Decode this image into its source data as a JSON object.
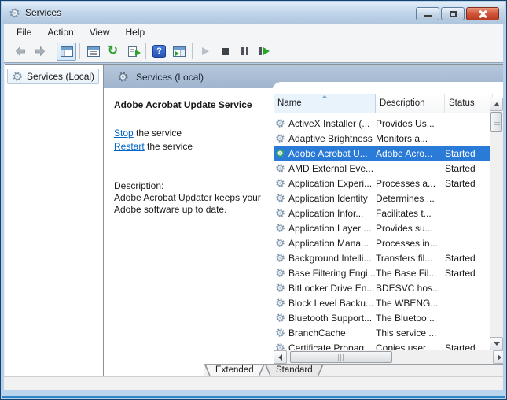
{
  "window": {
    "title": "Services"
  },
  "menu": {
    "items": [
      {
        "label": "File"
      },
      {
        "label": "Action"
      },
      {
        "label": "View"
      },
      {
        "label": "Help"
      }
    ]
  },
  "toolbar": {
    "icons": [
      "back",
      "forward",
      "show-console-tree",
      "properties",
      "refresh",
      "export-list",
      "help",
      "show-action-pane",
      "start-service",
      "stop-service",
      "pause-service",
      "restart-service"
    ],
    "help_glyph": "?",
    "refresh_glyph": "↻"
  },
  "sidebar": {
    "root_label": "Services (Local)"
  },
  "extended_pane": {
    "header": "Services (Local)",
    "service_title": "Adobe Acrobat Update Service",
    "stop_link": "Stop",
    "stop_suffix": " the service",
    "restart_link": "Restart",
    "restart_suffix": " the service",
    "description_label": "Description:",
    "description_text": "Adobe Acrobat Updater keeps your Adobe software up to date."
  },
  "services": {
    "columns": [
      "Name",
      "Description",
      "Status"
    ],
    "sorted_by": "Name",
    "sort_direction": "ascending",
    "rows": [
      {
        "name": "ActiveX Installer (...",
        "description": "Provides Us...",
        "status": "",
        "selected": false
      },
      {
        "name": "Adaptive Brightness",
        "description": "Monitors a...",
        "status": "",
        "selected": false
      },
      {
        "name": "Adobe Acrobat U...",
        "description": "Adobe Acro...",
        "status": "Started",
        "selected": true
      },
      {
        "name": "AMD External Eve...",
        "description": "",
        "status": "Started",
        "selected": false
      },
      {
        "name": "Application Experi...",
        "description": "Processes a...",
        "status": "Started",
        "selected": false
      },
      {
        "name": "Application Identity",
        "description": "Determines ...",
        "status": "",
        "selected": false
      },
      {
        "name": "Application Infor...",
        "description": "Facilitates t...",
        "status": "",
        "selected": false
      },
      {
        "name": "Application Layer ...",
        "description": "Provides su...",
        "status": "",
        "selected": false
      },
      {
        "name": "Application Mana...",
        "description": "Processes in...",
        "status": "",
        "selected": false
      },
      {
        "name": "Background Intelli...",
        "description": "Transfers fil...",
        "status": "Started",
        "selected": false
      },
      {
        "name": "Base Filtering Engi...",
        "description": "The Base Fil...",
        "status": "Started",
        "selected": false
      },
      {
        "name": "BitLocker Drive En...",
        "description": "BDESVC hos...",
        "status": "",
        "selected": false
      },
      {
        "name": "Block Level Backu...",
        "description": "The WBENG...",
        "status": "",
        "selected": false
      },
      {
        "name": "Bluetooth Support...",
        "description": "The Bluetoo...",
        "status": "",
        "selected": false
      },
      {
        "name": "BranchCache",
        "description": "This service ...",
        "status": "",
        "selected": false
      },
      {
        "name": "Certificate Propag...",
        "description": "Copies user...",
        "status": "Started",
        "selected": false
      }
    ]
  },
  "tabs": {
    "items": [
      {
        "label": "Extended",
        "active": true
      },
      {
        "label": "Standard",
        "active": false
      }
    ]
  },
  "colors": {
    "selection_blue": "#2a7ad8",
    "link_blue": "#0066cc",
    "band_blue": "#a9bdd4",
    "close_red": "#cf4631"
  }
}
